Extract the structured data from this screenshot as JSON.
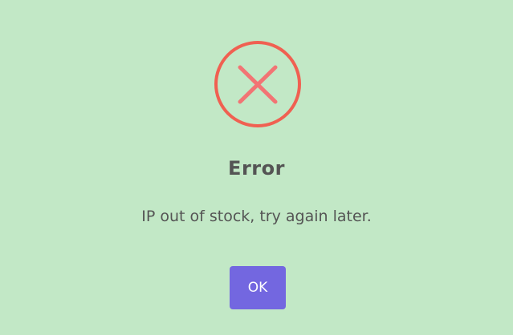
{
  "dialog": {
    "icon": "error-x-icon",
    "icon_color": "#f27474",
    "title": "Error",
    "message": "IP out of stock, try again later.",
    "ok_label": "OK",
    "button_color": "#7367e0",
    "background_color": "#c2e8c6"
  }
}
